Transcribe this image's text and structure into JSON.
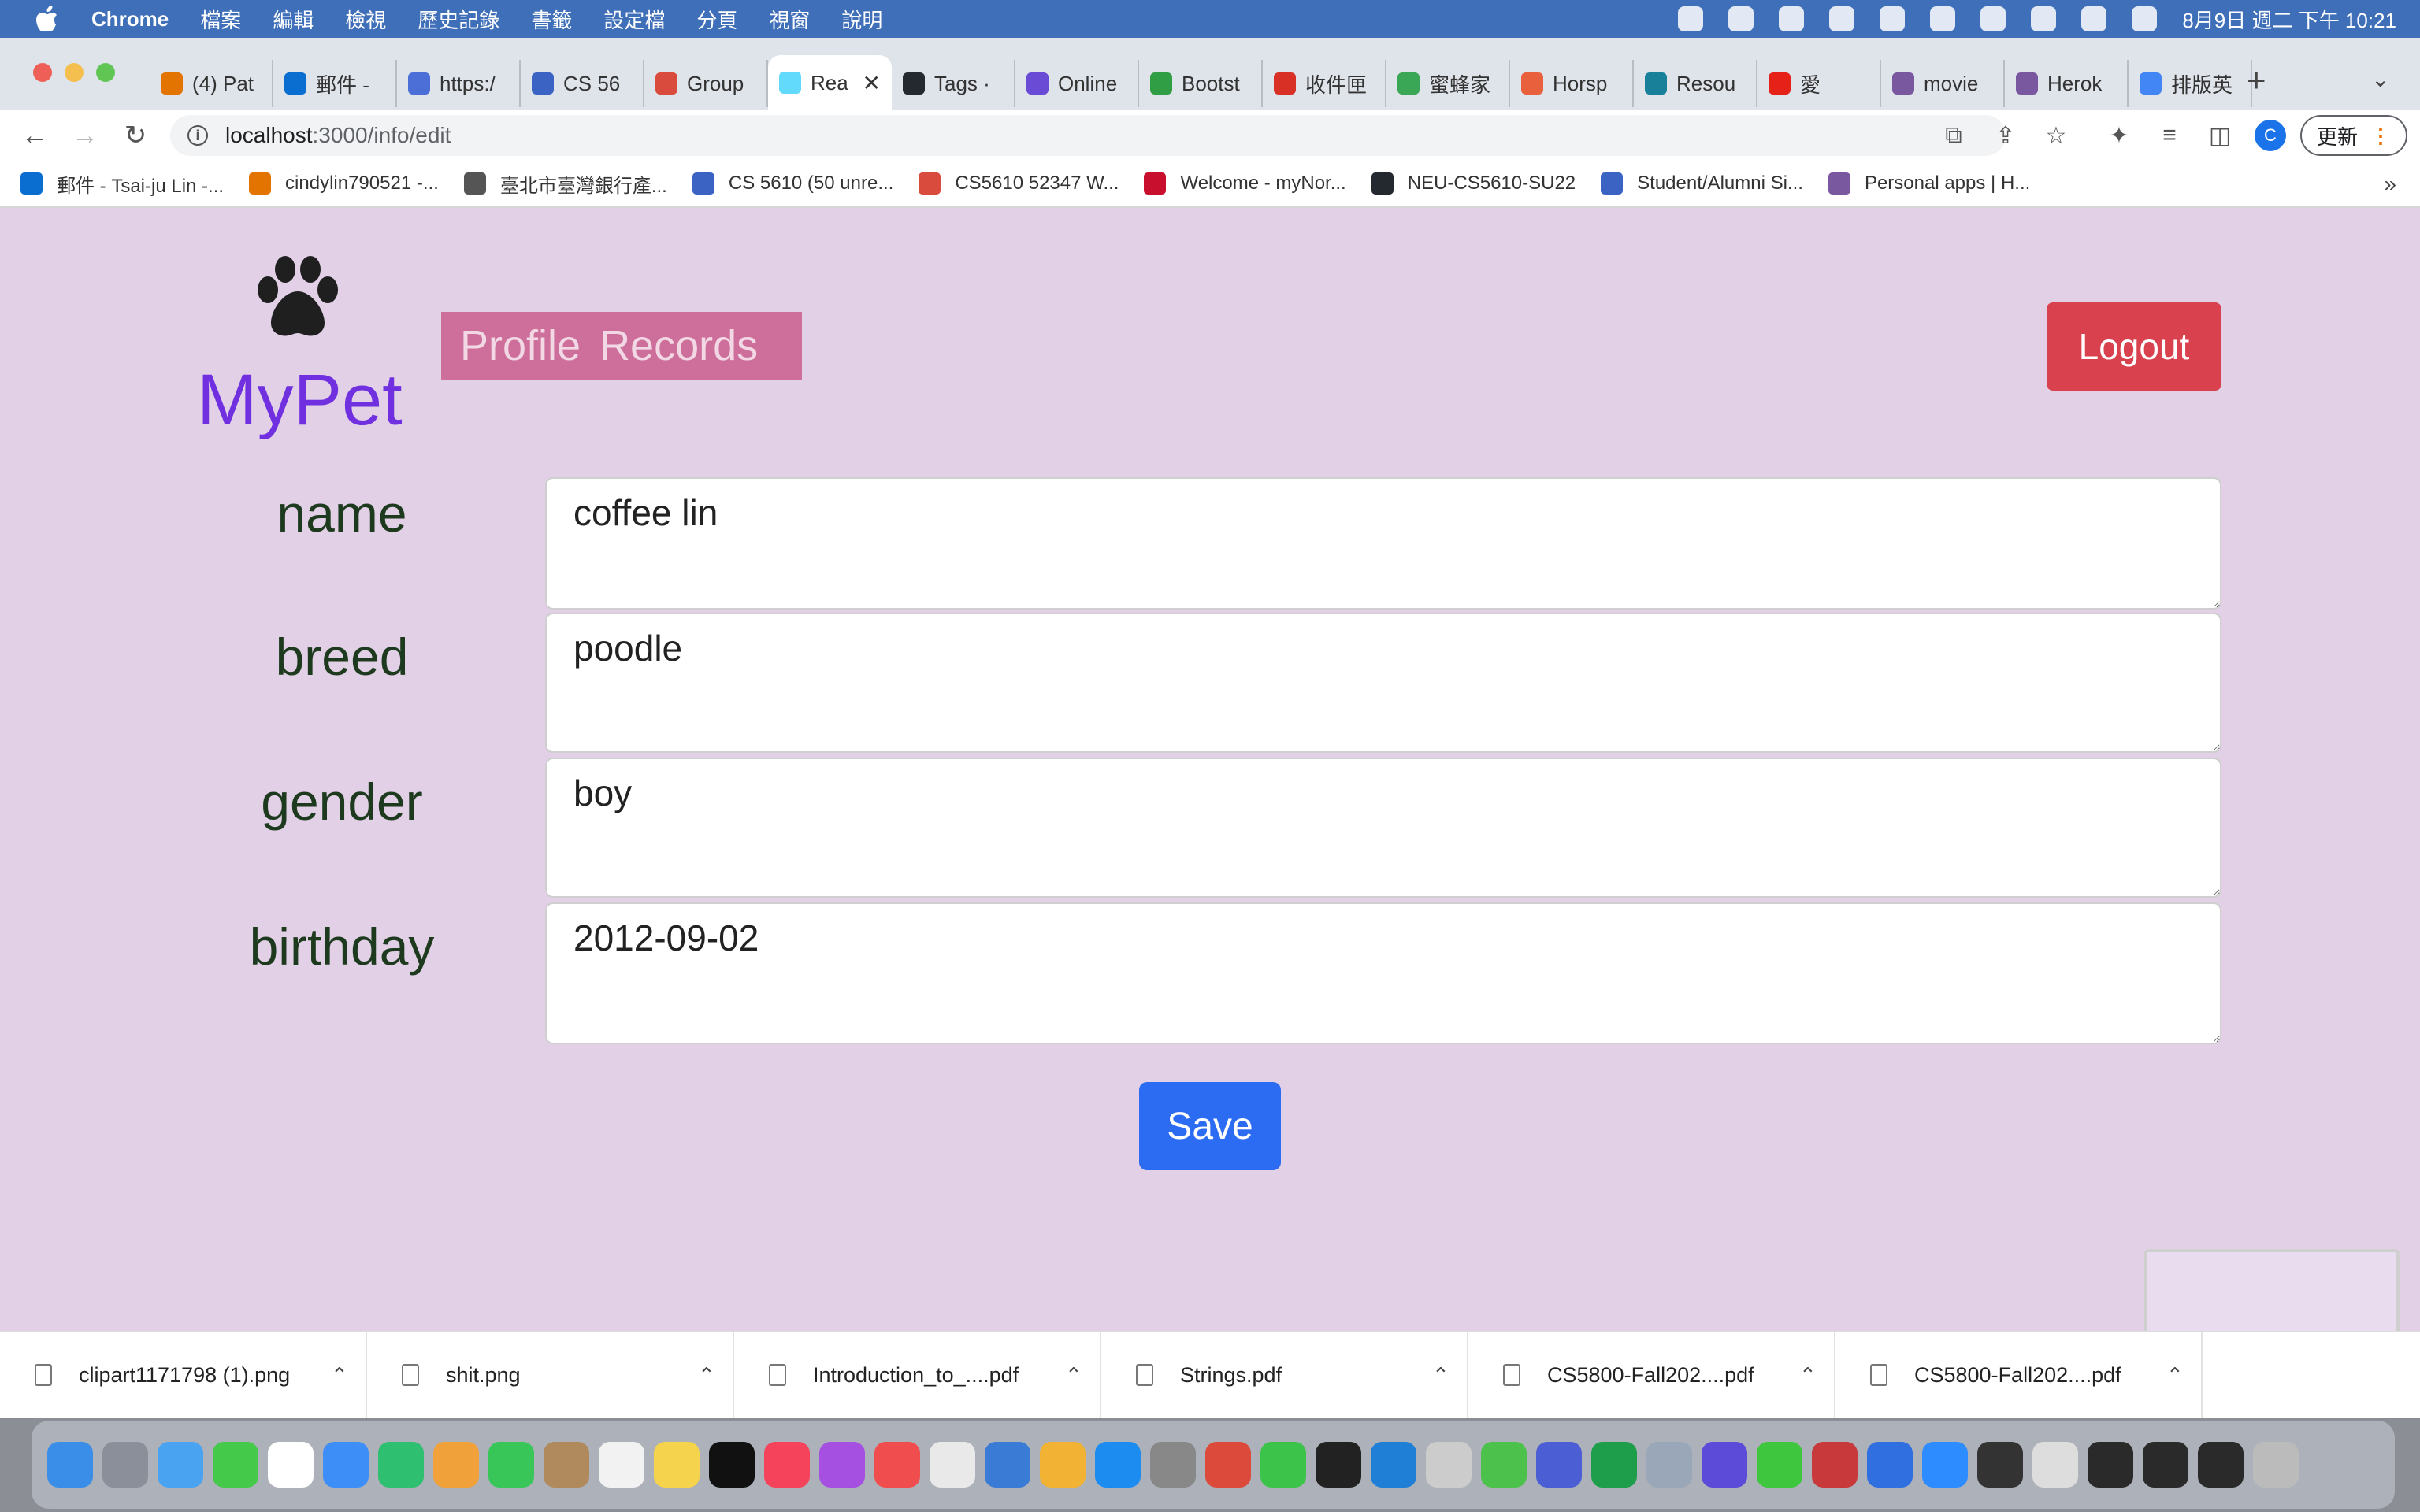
{
  "menubar": {
    "app_name": "Chrome",
    "items": [
      "檔案",
      "編輯",
      "檢視",
      "歷史記錄",
      "書籤",
      "設定檔",
      "分頁",
      "視窗",
      "說明"
    ],
    "clock": "8月9日 週二 下午 10:21"
  },
  "browser": {
    "tabs": [
      {
        "label": "(4) Pat",
        "color": "#e37400"
      },
      {
        "label": "郵件 -",
        "color": "#0a6ed1"
      },
      {
        "label": "https:/",
        "color": "#4b6fd6"
      },
      {
        "label": "CS 56",
        "color": "#3b63c4"
      },
      {
        "label": "Group",
        "color": "#d94b3c"
      },
      {
        "label": "Rea",
        "color": "#61dafb",
        "active": true
      },
      {
        "label": "Tags ·",
        "color": "#24292f"
      },
      {
        "label": "Online",
        "color": "#6a4bd6"
      },
      {
        "label": "Bootst",
        "color": "#2f9e44"
      },
      {
        "label": "收件匣",
        "color": "#d93025"
      },
      {
        "label": "蜜蜂家",
        "color": "#3aa757"
      },
      {
        "label": "Horsp",
        "color": "#e8603c"
      },
      {
        "label": "Resou",
        "color": "#188098"
      },
      {
        "label": "愛",
        "color": "#e62117"
      },
      {
        "label": "movie",
        "color": "#79589f"
      },
      {
        "label": "Herok",
        "color": "#79589f"
      },
      {
        "label": "排版英",
        "color": "#4285f4"
      }
    ],
    "url_host": "localhost",
    "url_path": ":3000/info/edit",
    "profile_initial": "C",
    "update_label": "更新"
  },
  "bookmarks": [
    {
      "label": "郵件 - Tsai-ju Lin -...",
      "color": "#0a6ed1"
    },
    {
      "label": "cindylin790521 -...",
      "color": "#e37400"
    },
    {
      "label": "臺北市臺灣銀行產...",
      "color": "#555555"
    },
    {
      "label": "CS 5610 (50 unre...",
      "color": "#3b63c4"
    },
    {
      "label": "CS5610 52347 W...",
      "color": "#d94b3c"
    },
    {
      "label": "Welcome - myNor...",
      "color": "#c8102e"
    },
    {
      "label": "NEU-CS5610-SU22",
      "color": "#24292f"
    },
    {
      "label": "Student/Alumni Si...",
      "color": "#3b63c4"
    },
    {
      "label": "Personal apps | H...",
      "color": "#79589f"
    }
  ],
  "app": {
    "brand": "MyPet",
    "nav": {
      "profile": "Profile",
      "records": "Records"
    },
    "logout_label": "Logout",
    "fields": [
      {
        "label": "name",
        "value": "coffee lin"
      },
      {
        "label": "breed",
        "value": "poodle"
      },
      {
        "label": "gender",
        "value": "boy"
      },
      {
        "label": "birthday",
        "value": "2012-09-02"
      }
    ],
    "save_label": "Save",
    "colors": {
      "brand": "#7030e0",
      "nav_bg": "#cd6f9a",
      "logout": "#d9414e",
      "save": "#2b6cf3",
      "page_bg": "#e1d0e6"
    }
  },
  "downloads": [
    "clipart1171798 (1).png",
    "shit.png",
    "Introduction_to_....pdf",
    "Strings.pdf",
    "CS5800-Fall202....pdf",
    "CS5800-Fall202....pdf"
  ]
}
